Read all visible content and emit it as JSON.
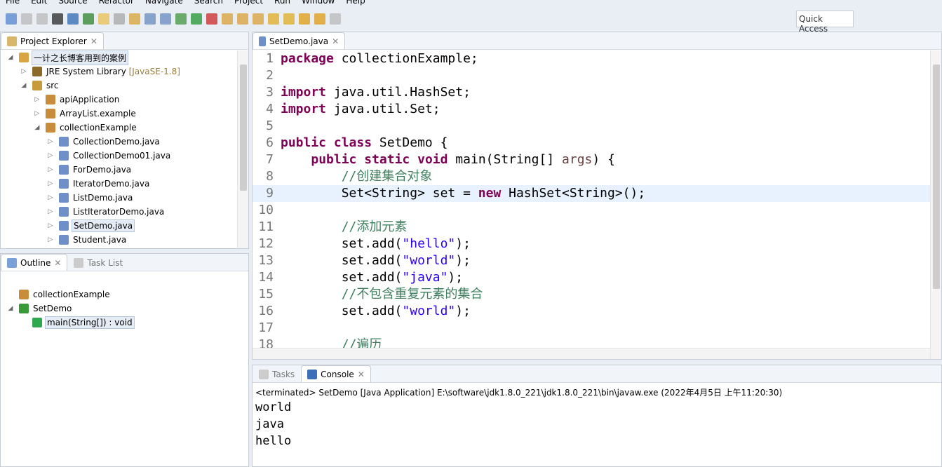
{
  "menu": [
    "File",
    "Edit",
    "Source",
    "Refactor",
    "Navigate",
    "Search",
    "Project",
    "Run",
    "Window",
    "Help"
  ],
  "quick_access": "Quick Access",
  "project_explorer": {
    "title": "Project Explorer",
    "items": [
      {
        "label": "一计之长博客用到的案例",
        "depth": 0,
        "tw": "◢",
        "icon": "project-icon",
        "color": "#d9a441",
        "sel": true
      },
      {
        "label": "JRE System Library",
        "deco": " [JavaSE-1.8]",
        "depth": 1,
        "tw": "▷",
        "icon": "library-icon",
        "color": "#8b6a2a"
      },
      {
        "label": "src",
        "depth": 1,
        "tw": "◢",
        "icon": "source-folder-icon",
        "color": "#c79a3c"
      },
      {
        "label": "apiApplication",
        "depth": 2,
        "tw": "▷",
        "icon": "package-icon",
        "color": "#c98c3a"
      },
      {
        "label": "ArrayList.example",
        "depth": 2,
        "tw": "▷",
        "icon": "package-icon",
        "color": "#c98c3a"
      },
      {
        "label": "collectionExample",
        "depth": 2,
        "tw": "◢",
        "icon": "package-icon",
        "color": "#c98c3a"
      },
      {
        "label": "CollectionDemo.java",
        "depth": 3,
        "tw": "▷",
        "icon": "java-file-icon",
        "color": "#6f8fc9"
      },
      {
        "label": "CollectionDemo01.java",
        "depth": 3,
        "tw": "▷",
        "icon": "java-file-icon",
        "color": "#6f8fc9"
      },
      {
        "label": "ForDemo.java",
        "depth": 3,
        "tw": "▷",
        "icon": "java-file-icon",
        "color": "#6f8fc9"
      },
      {
        "label": "IteratorDemo.java",
        "depth": 3,
        "tw": "▷",
        "icon": "java-file-icon",
        "color": "#6f8fc9"
      },
      {
        "label": "ListDemo.java",
        "depth": 3,
        "tw": "▷",
        "icon": "java-file-icon",
        "color": "#6f8fc9"
      },
      {
        "label": "ListIteratorDemo.java",
        "depth": 3,
        "tw": "▷",
        "icon": "java-file-icon",
        "color": "#6f8fc9"
      },
      {
        "label": "SetDemo.java",
        "depth": 3,
        "tw": "▷",
        "icon": "java-file-icon",
        "color": "#6f8fc9",
        "sel": true
      },
      {
        "label": "Student.java",
        "depth": 3,
        "tw": "▷",
        "icon": "java-file-icon",
        "color": "#6f8fc9"
      }
    ]
  },
  "outline": {
    "title": "Outline",
    "task_list": "Task List",
    "items": [
      {
        "label": "collectionExample",
        "depth": 0,
        "tw": "",
        "icon": "package-icon",
        "color": "#c98c3a"
      },
      {
        "label": "SetDemo",
        "depth": 0,
        "tw": "◢",
        "icon": "class-icon",
        "color": "#3a9a3a"
      },
      {
        "label": "main(String[]) : void",
        "depth": 1,
        "tw": "",
        "icon": "method-icon",
        "color": "#2fa84f",
        "sel": true
      }
    ]
  },
  "editor": {
    "tab": "SetDemo.java",
    "current_line": 9,
    "lines": [
      [
        [
          "kw",
          "package"
        ],
        [
          "t",
          " collectionExample;"
        ]
      ],
      [],
      [
        [
          "kw",
          "import"
        ],
        [
          "t",
          " java.util.HashSet;"
        ]
      ],
      [
        [
          "kw",
          "import"
        ],
        [
          "t",
          " java.util.Set;"
        ]
      ],
      [],
      [
        [
          "kw",
          "public"
        ],
        [
          "t",
          " "
        ],
        [
          "kw",
          "class"
        ],
        [
          "t",
          " SetDemo {"
        ]
      ],
      [
        [
          "t",
          "    "
        ],
        [
          "kw",
          "public"
        ],
        [
          "t",
          " "
        ],
        [
          "kw",
          "static"
        ],
        [
          "t",
          " "
        ],
        [
          "kw",
          "void"
        ],
        [
          "t",
          " main(String[] "
        ],
        [
          "arg",
          "args"
        ],
        [
          "t",
          ") {"
        ]
      ],
      [
        [
          "t",
          "        "
        ],
        [
          "cm",
          "//创建集合对象"
        ]
      ],
      [
        [
          "t",
          "        Set<String> set = "
        ],
        [
          "kw",
          "new"
        ],
        [
          "t",
          " HashSet<String>();"
        ]
      ],
      [],
      [
        [
          "t",
          "        "
        ],
        [
          "cm",
          "//添加元素"
        ]
      ],
      [
        [
          "t",
          "        set.add("
        ],
        [
          "str",
          "\"hello\""
        ],
        [
          "t",
          ");"
        ]
      ],
      [
        [
          "t",
          "        set.add("
        ],
        [
          "str",
          "\"world\""
        ],
        [
          "t",
          ");"
        ]
      ],
      [
        [
          "t",
          "        set.add("
        ],
        [
          "str",
          "\"java\""
        ],
        [
          "t",
          ");"
        ]
      ],
      [
        [
          "t",
          "        "
        ],
        [
          "cm",
          "//不包含重复元素的集合"
        ]
      ],
      [
        [
          "t",
          "        set.add("
        ],
        [
          "str",
          "\"world\""
        ],
        [
          "t",
          ");"
        ]
      ],
      [],
      [
        [
          "t",
          "        "
        ],
        [
          "cm",
          "//遍历"
        ]
      ]
    ]
  },
  "console": {
    "tasks_tab": "Tasks",
    "tab": "Console",
    "header": "<terminated> SetDemo [Java Application] E:\\software\\jdk1.8.0_221\\jdk1.8.0_221\\bin\\javaw.exe (2022年4月5日 上午11:20:30)",
    "output": [
      "world",
      "java",
      "hello"
    ]
  }
}
